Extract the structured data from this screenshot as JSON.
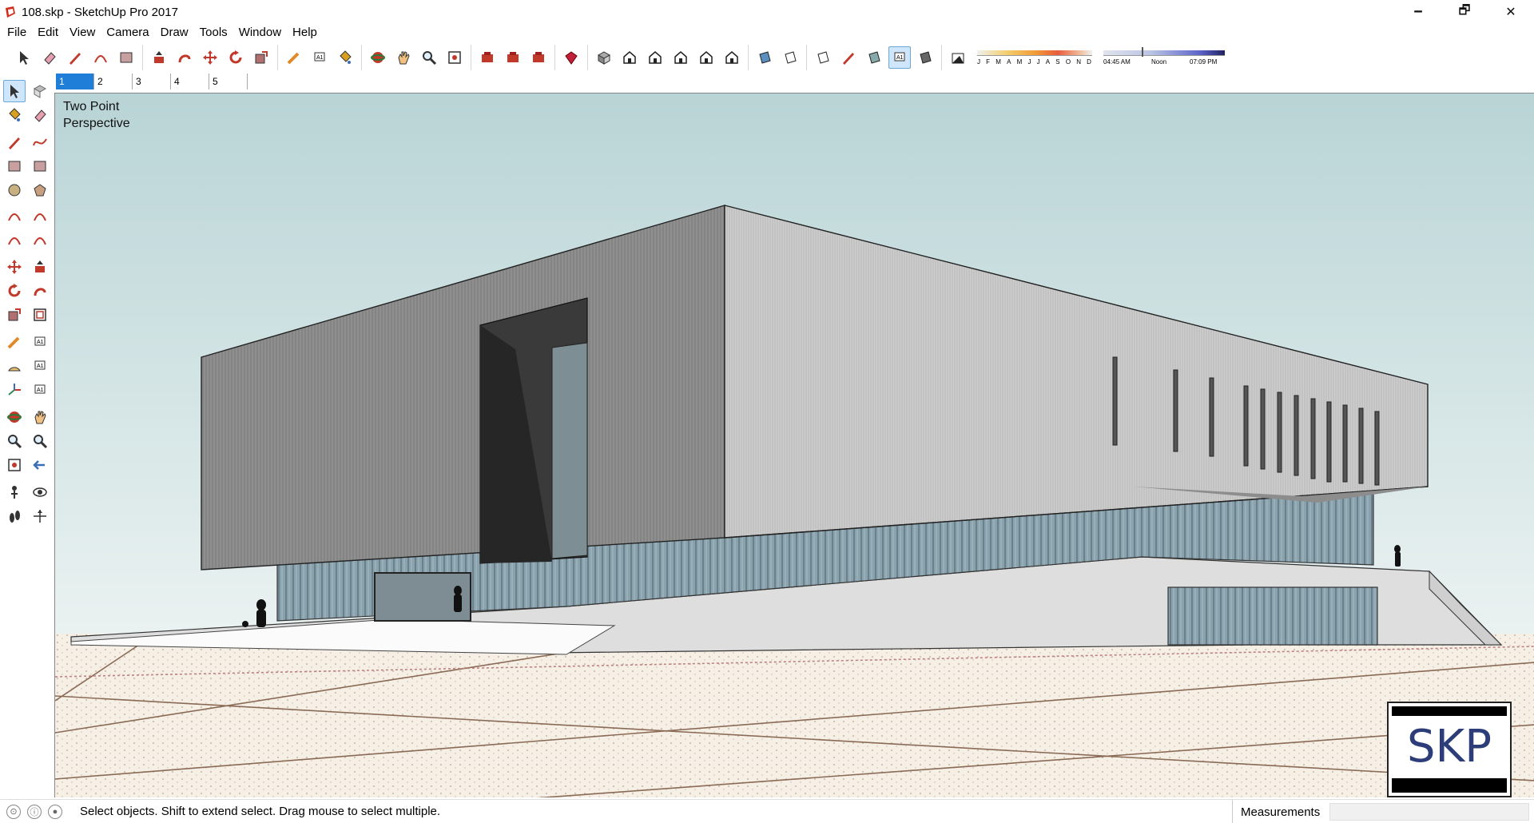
{
  "window": {
    "title": "108.skp - SketchUp Pro 2017",
    "minimize_label": "🗕",
    "maximize_label": "🗗",
    "close_label": "✕"
  },
  "menu": [
    "File",
    "Edit",
    "View",
    "Camera",
    "Draw",
    "Tools",
    "Window",
    "Help"
  ],
  "toolbar": {
    "groups": [
      [
        "select-tool-icon",
        "eraser-tool-icon",
        "pencil-dropdown-icon",
        "arc-dropdown-icon",
        "shape-dropdown-icon"
      ],
      [
        "push-pull-icon",
        "follow-me-icon",
        "move-icon",
        "rotate-icon",
        "scale-icon"
      ],
      [
        "tape-measure-icon",
        "text-tool-icon",
        "paint-bucket-icon"
      ],
      [
        "orbit-icon",
        "pan-icon",
        "zoom-icon",
        "zoom-extents-icon"
      ],
      [
        "3d-warehouse-icon",
        "extension-warehouse-icon",
        "layout-icon"
      ],
      [
        "ruby-console-icon"
      ],
      [
        "iso-view-icon",
        "top-view-icon",
        "front-view-icon",
        "right-view-icon",
        "back-view-icon",
        "left-view-icon"
      ],
      [
        "xray-icon",
        "back-edges-icon"
      ],
      [
        "wireframe-icon",
        "hidden-line-icon",
        "shaded-icon",
        "shaded-textures-icon",
        "monochrome-icon"
      ],
      [
        "shadows-icon"
      ]
    ],
    "active": [
      "shaded-textures-icon"
    ]
  },
  "shadow": {
    "months": [
      "J",
      "F",
      "M",
      "A",
      "M",
      "J",
      "J",
      "A",
      "S",
      "O",
      "N",
      "D"
    ],
    "time_start": "04:45 AM",
    "time_mid": "Noon",
    "time_end": "07:09 PM"
  },
  "scenes": {
    "tabs": [
      "1",
      "2",
      "3",
      "4",
      "5"
    ],
    "active_index": 0
  },
  "left_toolbar": [
    [
      "select-icon",
      "component-icon"
    ],
    [
      "paint-bucket-icon",
      "eraser-icon"
    ],
    [
      "line-icon",
      "freehand-icon"
    ],
    [
      "rectangle-icon",
      "rotated-rectangle-icon"
    ],
    [
      "circle-icon",
      "polygon-icon"
    ],
    [
      "arc-icon",
      "two-point-arc-icon"
    ],
    [
      "three-point-arc-icon",
      "pie-icon"
    ],
    [
      "move-icon",
      "push-pull-icon"
    ],
    [
      "rotate-icon",
      "follow-me-icon"
    ],
    [
      "scale-icon",
      "offset-icon"
    ],
    [
      "tape-measure-icon",
      "dimension-icon"
    ],
    [
      "protractor-icon",
      "text-icon"
    ],
    [
      "axes-icon",
      "3d-text-icon"
    ],
    [
      "orbit-icon",
      "pan-icon"
    ],
    [
      "zoom-icon",
      "zoom-window-icon"
    ],
    [
      "zoom-extents-icon",
      "previous-view-icon"
    ],
    [
      "position-camera-icon",
      "look-around-icon"
    ],
    [
      "walk-icon",
      "section-plane-icon"
    ]
  ],
  "viewport": {
    "scene_label_line1": "Two Point",
    "scene_label_line2": "Perspective",
    "badge_text": "SKP"
  },
  "status": {
    "message": "Select objects. Shift to extend select. Drag mouse to select multiple.",
    "measurements_label": "Measurements",
    "measurements_value": ""
  },
  "colors": {
    "sky_top": "#b9d4d6",
    "sky_bottom": "#eaf2f1",
    "ground": "#f4eee6",
    "facade_left": "#8e8e8e",
    "facade_right": "#c8c8c8",
    "glass": "#7f99a6",
    "accent_blue": "#1e7ed8"
  }
}
